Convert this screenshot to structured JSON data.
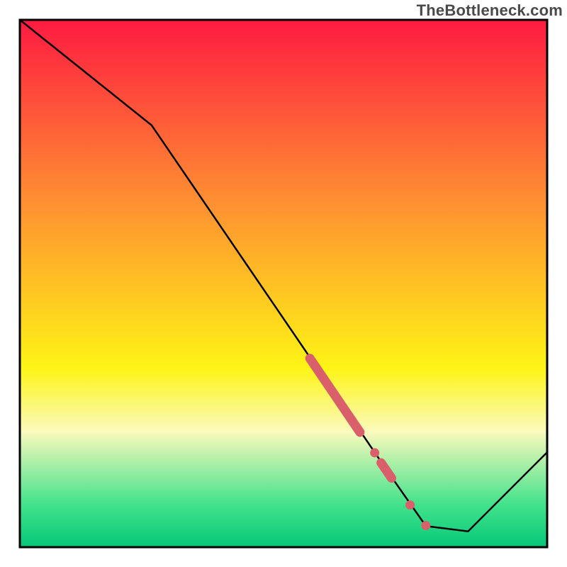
{
  "watermark": "TheBottleneck.com",
  "colors": {
    "red_top": "#fe1b41",
    "orange": "#fe9131",
    "yellow": "#fdf415",
    "pale_yellow": "#fbfabc",
    "green_mid": "#41e28b",
    "green_bottom": "#06c878",
    "line": "#000000",
    "marker": "#d9606a",
    "border": "#000000"
  },
  "chart_data": {
    "type": "line",
    "title": "",
    "xlabel": "",
    "ylabel": "",
    "xlim": [
      0,
      100
    ],
    "ylim": [
      0,
      100
    ],
    "grid": false,
    "series": [
      {
        "name": "bottleneck-curve",
        "x": [
          0,
          25,
          70,
          77,
          85,
          100
        ],
        "y": [
          100,
          80,
          14,
          4,
          3,
          18
        ]
      }
    ],
    "markers": [
      {
        "name": "highlight-segment-top",
        "kind": "thick-segment",
        "x0": 55.0,
        "y0": 35.8,
        "x1": 64.5,
        "y1": 21.8
      },
      {
        "name": "highlight-dot-1",
        "kind": "dot",
        "x": 67.3,
        "y": 17.9
      },
      {
        "name": "highlight-segment-mid",
        "kind": "thick-segment",
        "x0": 68.5,
        "y0": 16.0,
        "x1": 70.5,
        "y1": 13.1
      },
      {
        "name": "highlight-dot-2",
        "kind": "dot",
        "x": 74.0,
        "y": 8.0
      },
      {
        "name": "highlight-dot-3",
        "kind": "dot",
        "x": 77.0,
        "y": 4.1
      }
    ]
  }
}
